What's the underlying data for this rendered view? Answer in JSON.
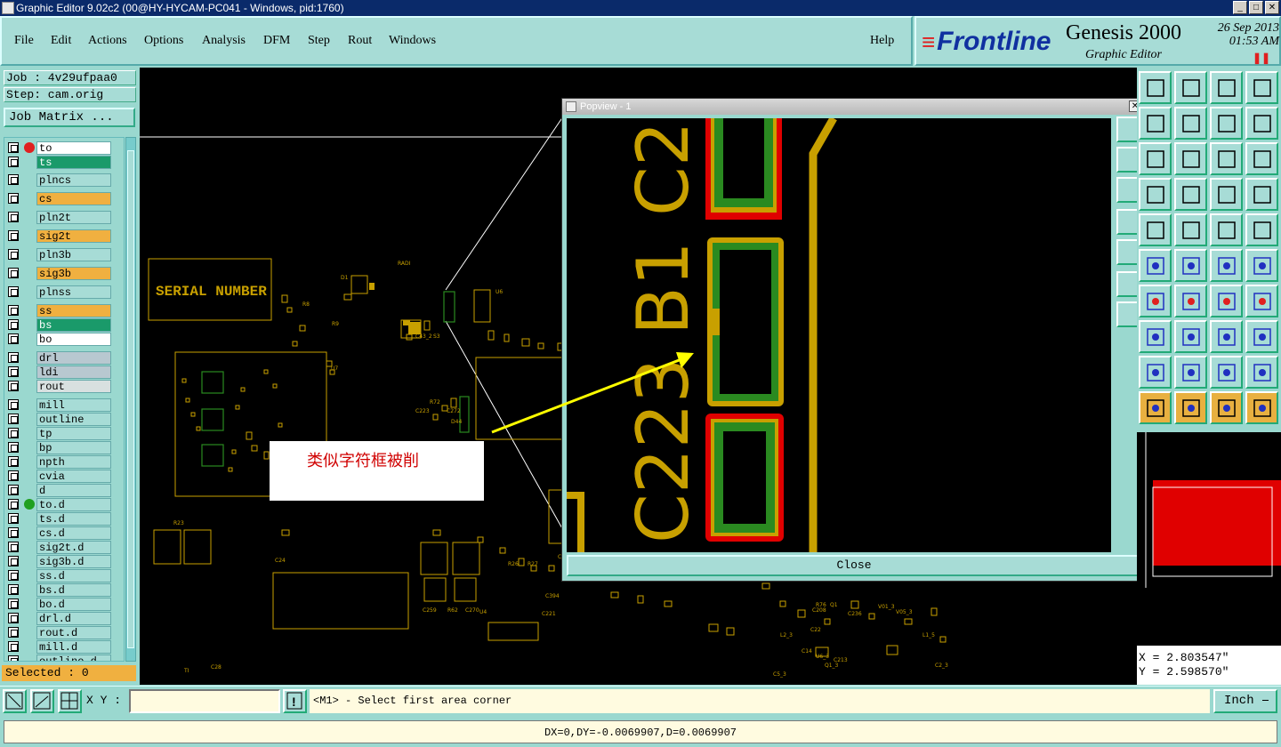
{
  "window": {
    "title": "Graphic Editor 9.02c2 (00@HY-HYCAM-PC041 - Windows, pid:1760)"
  },
  "menu": {
    "items": [
      "File",
      "Edit",
      "Actions",
      "Options",
      "Analysis",
      "DFM",
      "Step",
      "Rout",
      "Windows"
    ],
    "help": "Help"
  },
  "brand": {
    "logo": "Frontline",
    "product": "Genesis 2000",
    "subtitle": "Graphic Editor",
    "date": "26 Sep 2013",
    "time": "01:53 AM"
  },
  "job": {
    "job_label": "Job : 4v29ufpaa0",
    "step_label": "Step: cam.orig",
    "matrix_button": "Job Matrix ..."
  },
  "layers": [
    {
      "name": "to",
      "bg": "#ffffff",
      "dot": "#e02020"
    },
    {
      "name": "ts",
      "bg": "#1a9a6a",
      "dot": ""
    },
    {
      "name": "plncs",
      "bg": "#a7dcd6",
      "dot": ""
    },
    {
      "name": "cs",
      "bg": "#f0b040",
      "dot": ""
    },
    {
      "name": "pln2t",
      "bg": "#a7dcd6",
      "dot": ""
    },
    {
      "name": "sig2t",
      "bg": "#f0b040",
      "dot": ""
    },
    {
      "name": "pln3b",
      "bg": "#a7dcd6",
      "dot": ""
    },
    {
      "name": "sig3b",
      "bg": "#f0b040",
      "dot": ""
    },
    {
      "name": "plnss",
      "bg": "#a7dcd6",
      "dot": ""
    },
    {
      "name": "ss",
      "bg": "#f0b040",
      "dot": ""
    },
    {
      "name": "bs",
      "bg": "#1a9a6a",
      "dot": ""
    },
    {
      "name": "bo",
      "bg": "#ffffff",
      "dot": ""
    },
    {
      "name": "drl",
      "bg": "#b8c8d0",
      "dot": ""
    },
    {
      "name": "ldi",
      "bg": "#b8c8d0",
      "dot": ""
    },
    {
      "name": "rout",
      "bg": "#d8e0e0",
      "dot": ""
    },
    {
      "name": "mill",
      "bg": "#a7dcd6",
      "dot": ""
    },
    {
      "name": "outline",
      "bg": "#a7dcd6",
      "dot": ""
    },
    {
      "name": "tp",
      "bg": "#a7dcd6",
      "dot": ""
    },
    {
      "name": "bp",
      "bg": "#a7dcd6",
      "dot": ""
    },
    {
      "name": "npth",
      "bg": "#a7dcd6",
      "dot": ""
    },
    {
      "name": "cvia",
      "bg": "#a7dcd6",
      "dot": ""
    },
    {
      "name": "d",
      "bg": "#a7dcd6",
      "dot": ""
    },
    {
      "name": "to.d",
      "bg": "#a7dcd6",
      "dot": "#20a020"
    },
    {
      "name": "ts.d",
      "bg": "#a7dcd6",
      "dot": ""
    },
    {
      "name": "cs.d",
      "bg": "#a7dcd6",
      "dot": ""
    },
    {
      "name": "sig2t.d",
      "bg": "#a7dcd6",
      "dot": ""
    },
    {
      "name": "sig3b.d",
      "bg": "#a7dcd6",
      "dot": ""
    },
    {
      "name": "ss.d",
      "bg": "#a7dcd6",
      "dot": ""
    },
    {
      "name": "bs.d",
      "bg": "#a7dcd6",
      "dot": ""
    },
    {
      "name": "bo.d",
      "bg": "#a7dcd6",
      "dot": ""
    },
    {
      "name": "drl.d",
      "bg": "#a7dcd6",
      "dot": ""
    },
    {
      "name": "rout.d",
      "bg": "#a7dcd6",
      "dot": ""
    },
    {
      "name": "mill.d",
      "bg": "#a7dcd6",
      "dot": ""
    },
    {
      "name": "outline.d",
      "bg": "#a7dcd6",
      "dot": ""
    }
  ],
  "selected": "Selected : 0",
  "canvas": {
    "serial_label": "SERIAL NUMBER",
    "refdes": [
      "RADI",
      "D1",
      "R8",
      "R9",
      "C43_2",
      "S3",
      "U6",
      "U7",
      "C57",
      "C223",
      "R72",
      "C272",
      "D44",
      "R23",
      "C24",
      "R26",
      "R27",
      "C392",
      "C394",
      "TI",
      "C28",
      "C259",
      "R62",
      "C270",
      "U4",
      "C221",
      "R76",
      "Q1",
      "C208",
      "C236",
      "C213",
      "C14",
      "C22",
      "U6_3",
      "Q1_3",
      "C5_3",
      "C2_3",
      "V01_3",
      "V05_3",
      "L1_5",
      "L2_3"
    ]
  },
  "note": "类似字符框被削",
  "popview": {
    "title": "Popview - 1",
    "close_label": "Close",
    "silk_texts": [
      "C223",
      "B1",
      "C2"
    ]
  },
  "coords": {
    "x": "X = 2.803547\"",
    "y": "Y = 2.598570\""
  },
  "bottom": {
    "xy_label": "X Y :",
    "xy_value": "",
    "prompt": "<M1> - Select first area corner",
    "units": "Inch"
  },
  "status": "DX=0,DY=-0.0069907,D=0.0069907",
  "colors": {
    "accent": "#9ad8cf",
    "silk": "#c8a000",
    "mask": "#2a8a20",
    "red": "#e00000"
  }
}
